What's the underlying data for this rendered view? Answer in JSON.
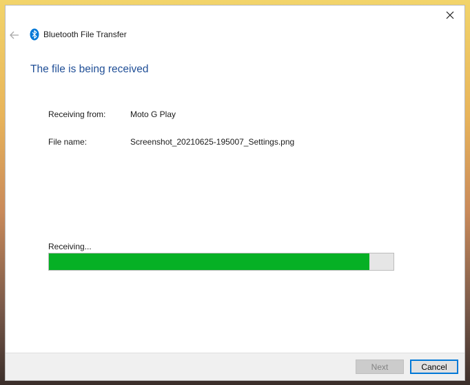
{
  "window": {
    "app_title": "Bluetooth File Transfer",
    "heading": "The file is being received"
  },
  "details": {
    "receiving_from_label": "Receiving from:",
    "receiving_from_value": "Moto G Play",
    "file_name_label": "File name:",
    "file_name_value": "Screenshot_20210625-195007_Settings.png"
  },
  "progress": {
    "status_text": "Receiving...",
    "percent": 93,
    "fill_color": "#06b025"
  },
  "footer": {
    "next_label": "Next",
    "cancel_label": "Cancel"
  },
  "icons": {
    "back": "back-arrow-icon",
    "bluetooth": "bluetooth-icon",
    "close": "close-icon"
  },
  "colors": {
    "heading": "#1f4e96",
    "bluetooth": "#0078d7",
    "focus_border": "#0078d7"
  }
}
